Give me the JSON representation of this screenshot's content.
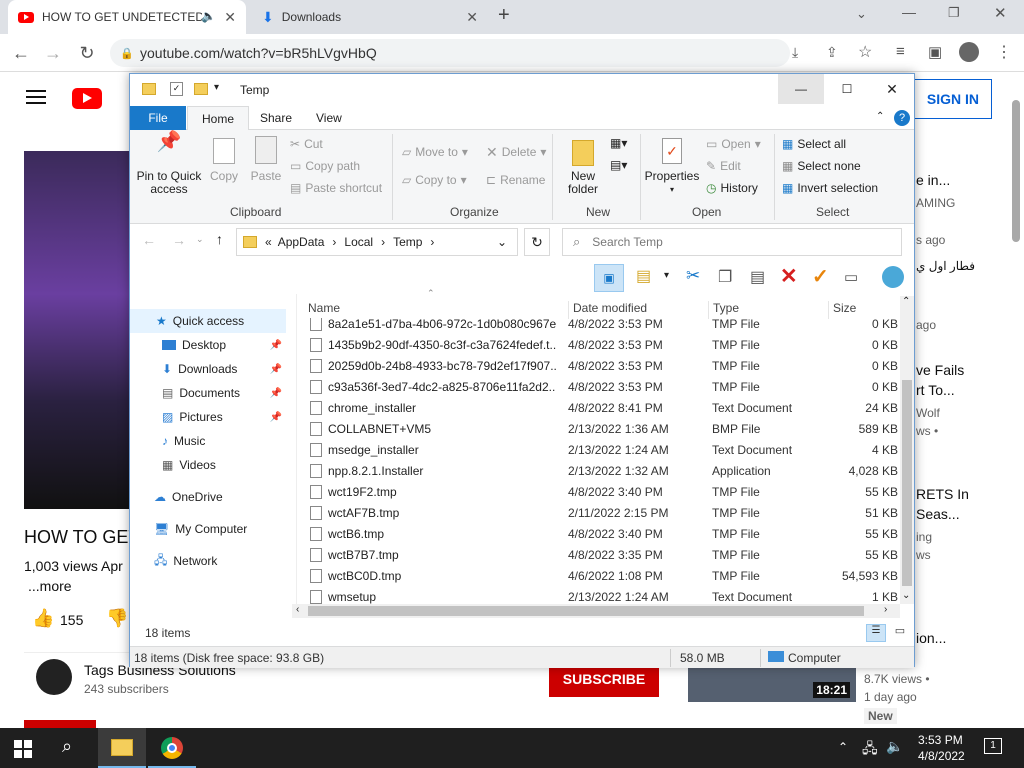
{
  "browser": {
    "tabs": [
      {
        "label": "HOW TO GET UNDETECTED"
      },
      {
        "label": "Downloads"
      }
    ],
    "url": "youtube.com/watch?v=bR5hLVgvHbQ"
  },
  "youtube": {
    "sign_in": "SIGN IN",
    "video_title": "HOW TO GET",
    "views_line": "1,003 views  Apr",
    "more": "...more",
    "likes": "155",
    "channel_name": "Tags Business Solutions",
    "subscribers": "243 subscribers",
    "subscribe": "SUBSCRIBE",
    "sidebar": [
      {
        "text": "e in...",
        "sub": "AMING"
      },
      {
        "text": "s ago",
        "sub": ""
      },
      {
        "text": "فطار اول ي",
        "sub": ""
      },
      {
        "text": "ago",
        "sub": ""
      },
      {
        "text": "ve Fails",
        "sub": "rt To..."
      },
      {
        "text": "Wolf",
        "sub": "ws •"
      },
      {
        "text": "RETS In",
        "sub": "Seas..."
      },
      {
        "text": "ing",
        "sub": "ws"
      },
      {
        "text": "ion...",
        "sub": ""
      }
    ],
    "bottom_card": {
      "duration": "18:21",
      "views": "8.7K views •",
      "ago": "1 day ago",
      "badge": "New"
    }
  },
  "explorer": {
    "title": "Temp",
    "ribbon_tabs": [
      "File",
      "Home",
      "Share",
      "View"
    ],
    "clipboard": {
      "pin": "Pin to Quick access",
      "copy": "Copy",
      "paste": "Paste",
      "cut": "Cut",
      "copy_path": "Copy path",
      "paste_shortcut": "Paste shortcut",
      "label": "Clipboard"
    },
    "organize": {
      "move_to": "Move to",
      "copy_to": "Copy to",
      "delete": "Delete",
      "rename": "Rename",
      "label": "Organize"
    },
    "new": {
      "new_folder": "New folder",
      "label": "New"
    },
    "open": {
      "properties": "Properties",
      "open": "Open",
      "edit": "Edit",
      "history": "History",
      "label": "Open"
    },
    "select": {
      "select_all": "Select all",
      "select_none": "Select none",
      "invert": "Invert selection",
      "label": "Select"
    },
    "path": [
      "AppData",
      "Local",
      "Temp"
    ],
    "search_placeholder": "Search Temp",
    "nav": [
      {
        "label": "Quick access"
      },
      {
        "label": "Desktop"
      },
      {
        "label": "Downloads"
      },
      {
        "label": "Documents"
      },
      {
        "label": "Pictures"
      },
      {
        "label": "Music"
      },
      {
        "label": "Videos"
      },
      {
        "label": "OneDrive"
      },
      {
        "label": "My Computer"
      },
      {
        "label": "Network"
      }
    ],
    "columns": {
      "name": "Name",
      "date": "Date modified",
      "type": "Type",
      "size": "Size"
    },
    "files": [
      {
        "name": "8a2a1e51-d7ba-4b06-972c-1d0b080c967e...",
        "date": "4/8/2022 3:53 PM",
        "type": "TMP File",
        "size": "0 KB"
      },
      {
        "name": "1435b9b2-90df-4350-8c3f-c3a7624fedef.t...",
        "date": "4/8/2022 3:53 PM",
        "type": "TMP File",
        "size": "0 KB"
      },
      {
        "name": "20259d0b-24b8-4933-bc78-79d2ef17f907....",
        "date": "4/8/2022 3:53 PM",
        "type": "TMP File",
        "size": "0 KB"
      },
      {
        "name": "c93a536f-3ed7-4dc2-a825-8706e11fa2d2....",
        "date": "4/8/2022 3:53 PM",
        "type": "TMP File",
        "size": "0 KB"
      },
      {
        "name": "chrome_installer",
        "date": "4/8/2022 8:41 PM",
        "type": "Text Document",
        "size": "24 KB"
      },
      {
        "name": "COLLABNET+VM5",
        "date": "2/13/2022 1:36 AM",
        "type": "BMP File",
        "size": "589 KB"
      },
      {
        "name": "msedge_installer",
        "date": "2/13/2022 1:24 AM",
        "type": "Text Document",
        "size": "4 KB"
      },
      {
        "name": "npp.8.2.1.Installer",
        "date": "2/13/2022 1:32 AM",
        "type": "Application",
        "size": "4,028 KB"
      },
      {
        "name": "wct19F2.tmp",
        "date": "4/8/2022 3:40 PM",
        "type": "TMP File",
        "size": "55 KB"
      },
      {
        "name": "wctAF7B.tmp",
        "date": "2/11/2022 2:15 PM",
        "type": "TMP File",
        "size": "51 KB"
      },
      {
        "name": "wctB6.tmp",
        "date": "4/8/2022 3:40 PM",
        "type": "TMP File",
        "size": "55 KB"
      },
      {
        "name": "wctB7B7.tmp",
        "date": "4/8/2022 3:35 PM",
        "type": "TMP File",
        "size": "55 KB"
      },
      {
        "name": "wctBC0D.tmp",
        "date": "4/6/2022 1:08 PM",
        "type": "TMP File",
        "size": "54,593 KB"
      },
      {
        "name": "wmsetup",
        "date": "2/13/2022 1:24 AM",
        "type": "Text Document",
        "size": "1 KB"
      }
    ],
    "item_count": "18 items",
    "status_left": "18 items (Disk free space: 93.8 GB)",
    "status_size": "58.0 MB",
    "status_location": "Computer"
  },
  "taskbar": {
    "time": "3:53 PM",
    "date": "4/8/2022",
    "notifications": "1"
  }
}
